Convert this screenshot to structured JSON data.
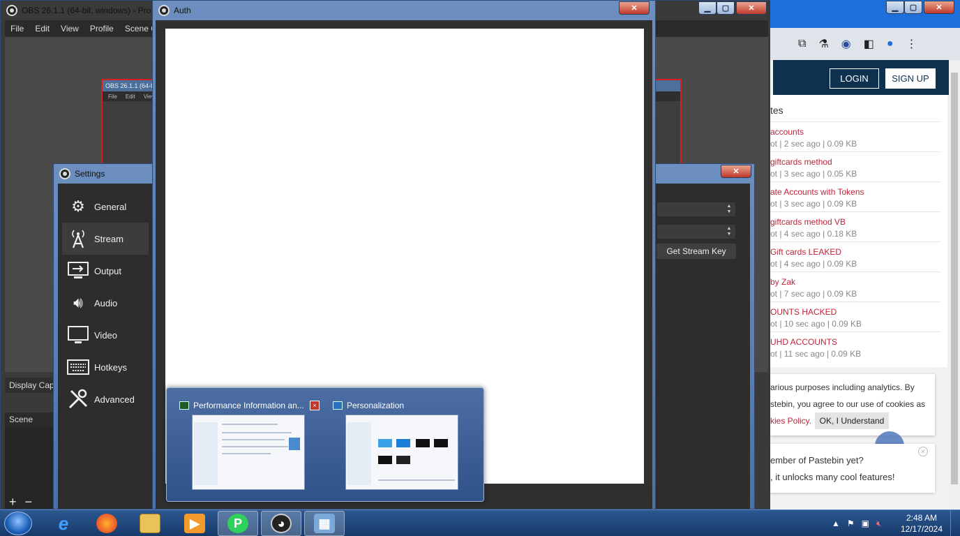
{
  "obs_main": {
    "title": "OBS 26.1.1 (64-bit, windows) - Pro",
    "menu": [
      "File",
      "Edit",
      "View",
      "Profile",
      "Scene C"
    ],
    "nested_title": "OBS 26.1.1 (64-bit",
    "nested_menu": [
      "File",
      "Edit",
      "View"
    ],
    "display_capture": "Display Captu",
    "scene_label": "Scene",
    "add_label": "+",
    "remove_label": "−"
  },
  "settings": {
    "title": "Settings",
    "nav": [
      {
        "label": "General",
        "icon": "gear-icon"
      },
      {
        "label": "Stream",
        "icon": "broadcast-icon"
      },
      {
        "label": "Output",
        "icon": "output-icon"
      },
      {
        "label": "Audio",
        "icon": "speaker-icon"
      },
      {
        "label": "Video",
        "icon": "monitor-icon"
      },
      {
        "label": "Hotkeys",
        "icon": "keyboard-icon"
      },
      {
        "label": "Advanced",
        "icon": "tools-icon"
      }
    ],
    "active": "Stream",
    "get_stream_key": "Get Stream Key"
  },
  "auth": {
    "title": "Auth"
  },
  "browser": {
    "login": "LOGIN",
    "signup": "SIGN UP",
    "list_title": "tes",
    "pastes": [
      {
        "title": "accounts",
        "meta": "ot | 2 sec ago | 0.09 KB"
      },
      {
        "title": "giftcards method",
        "meta": "ot | 3 sec ago | 0.05 KB"
      },
      {
        "title": "ate Accounts with Tokens",
        "meta": "ot | 3 sec ago | 0.09 KB"
      },
      {
        "title": "giftcards method VB",
        "meta": "ot | 4 sec ago | 0.18 KB"
      },
      {
        "title": "Gift cards LEAKED",
        "meta": "ot | 4 sec ago | 0.09 KB"
      },
      {
        "title": "by Zak",
        "meta": "ot | 7 sec ago | 0.09 KB"
      },
      {
        "title": "OUNTS HACKED",
        "meta": "ot | 10 sec ago | 0.09 KB"
      },
      {
        "title": "UHD ACCOUNTS",
        "meta": "ot | 11 sec ago | 0.09 KB"
      }
    ],
    "cookie_line1": "arious purposes including analytics. By",
    "cookie_line2": "stebin, you agree to our use of cookies as",
    "cookie_link": "kies Policy.",
    "cookie_ok": "OK, I Understand",
    "member_q": "ember of Pastebin yet?",
    "member_f": ", it unlocks many cool features!"
  },
  "thumbnails": [
    {
      "title": "Performance Information an...",
      "close": "×"
    },
    {
      "title": "Personalization"
    }
  ],
  "taskbar": {
    "time": "2:48 AM",
    "date": "12/17/2024"
  }
}
